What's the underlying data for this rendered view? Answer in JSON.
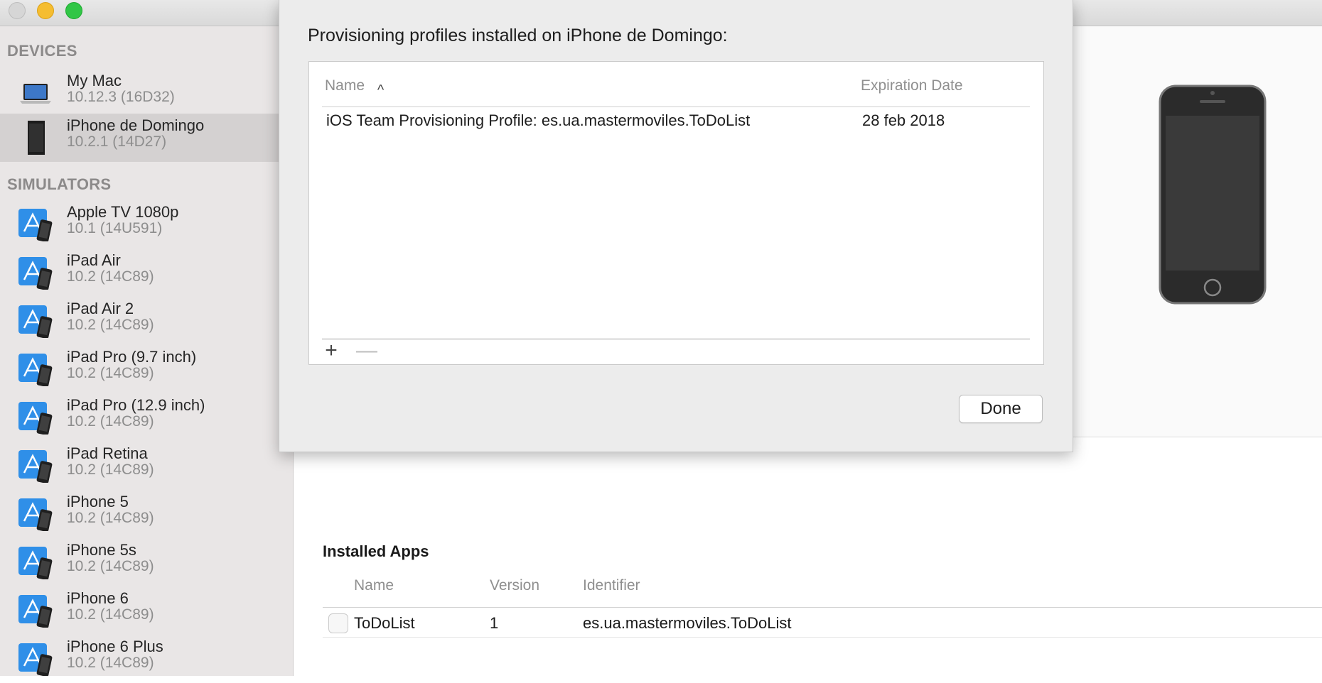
{
  "window": {
    "controls": [
      "close",
      "minimize",
      "maximize"
    ]
  },
  "sidebar": {
    "devices_header": "DEVICES",
    "simulators_header": "SIMULATORS",
    "devices": [
      {
        "name": "My Mac",
        "version": "10.12.3 (16D32)",
        "icon": "laptop-icon"
      },
      {
        "name": "iPhone de Domingo",
        "version": "10.2.1 (14D27)",
        "icon": "iphone-icon",
        "selected": true
      }
    ],
    "simulators": [
      {
        "name": "Apple TV 1080p",
        "version": "10.1 (14U591)"
      },
      {
        "name": "iPad Air",
        "version": "10.2 (14C89)"
      },
      {
        "name": "iPad Air 2",
        "version": "10.2 (14C89)"
      },
      {
        "name": "iPad Pro (9.7 inch)",
        "version": "10.2 (14C89)"
      },
      {
        "name": "iPad Pro (12.9 inch)",
        "version": "10.2 (14C89)"
      },
      {
        "name": "iPad Retina",
        "version": "10.2 (14C89)"
      },
      {
        "name": "iPhone 5",
        "version": "10.2 (14C89)"
      },
      {
        "name": "iPhone 5s",
        "version": "10.2 (14C89)"
      },
      {
        "name": "iPhone 6",
        "version": "10.2 (14C89)"
      },
      {
        "name": "iPhone 6 Plus",
        "version": "10.2 (14C89)"
      }
    ]
  },
  "sheet": {
    "title": "Provisioning profiles installed on iPhone de Domingo:",
    "columns": {
      "name": "Name",
      "expiration": "Expiration Date"
    },
    "sort_indicator": "^",
    "rows": [
      {
        "name": "iOS Team Provisioning Profile: es.ua.mastermoviles.ToDoList",
        "expiration": "28 feb 2018"
      }
    ],
    "add_label": "+",
    "remove_label": "—",
    "done_label": "Done"
  },
  "installed_apps": {
    "title": "Installed Apps",
    "columns": {
      "name": "Name",
      "version": "Version",
      "identifier": "Identifier"
    },
    "rows": [
      {
        "name": "ToDoList",
        "version": "1",
        "identifier": "es.ua.mastermoviles.ToDoList"
      }
    ]
  },
  "colors": {
    "sidebar_bg": "#e9e6e6",
    "selected_row": "#d4d1d1",
    "sheet_bg": "#ececec",
    "close": "#d6d6d6",
    "minimize": "#f5bd30",
    "maximize": "#31c646",
    "xcode_blue": "#2f8fe8"
  }
}
